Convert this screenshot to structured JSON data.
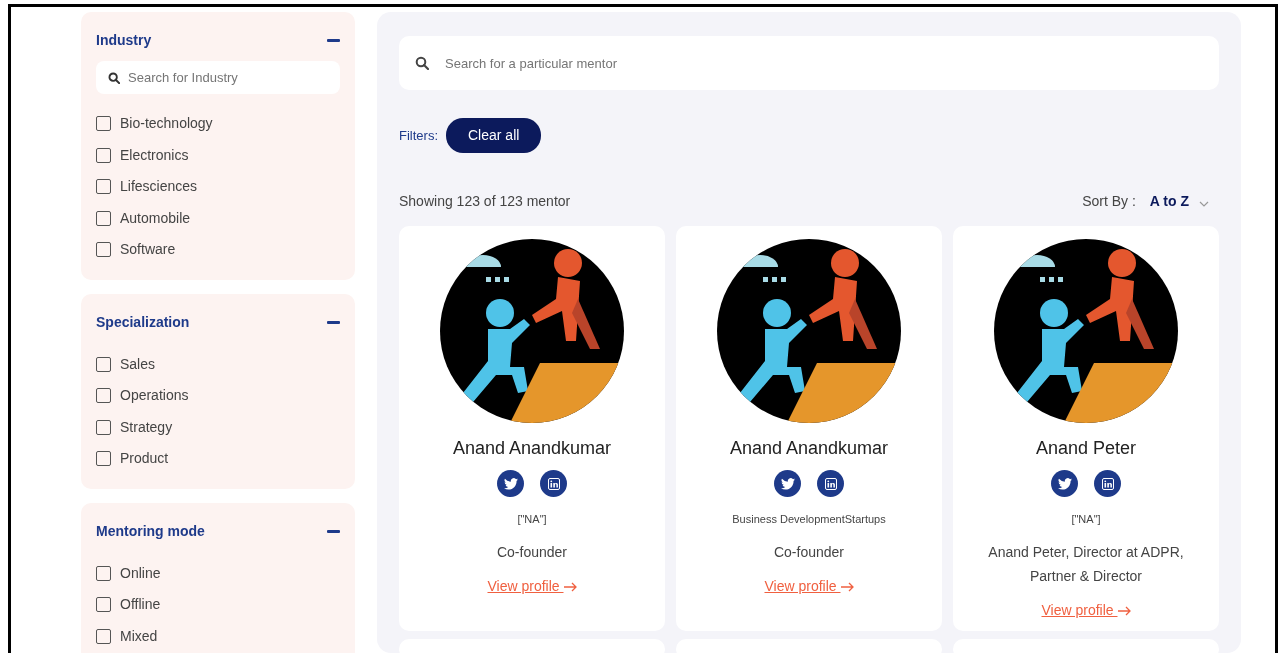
{
  "filters": [
    {
      "title": "Industry",
      "expanded": true,
      "search_placeholder": "Search for Industry",
      "options": [
        {
          "label": "Bio-technology",
          "checked": false
        },
        {
          "label": "Electronics",
          "checked": false
        },
        {
          "label": "Lifesciences",
          "checked": false
        },
        {
          "label": "Automobile",
          "checked": false
        },
        {
          "label": "Software",
          "checked": false
        }
      ]
    },
    {
      "title": "Specialization",
      "expanded": true,
      "options": [
        {
          "label": "Sales",
          "checked": false
        },
        {
          "label": "Operations",
          "checked": false
        },
        {
          "label": "Strategy",
          "checked": false
        },
        {
          "label": "Product",
          "checked": false
        }
      ]
    },
    {
      "title": "Mentoring mode",
      "expanded": true,
      "options": [
        {
          "label": "Online",
          "checked": false
        },
        {
          "label": "Offline",
          "checked": false
        },
        {
          "label": "Mixed",
          "checked": false
        }
      ]
    }
  ],
  "search": {
    "placeholder": "Search for a particular mentor"
  },
  "filters_label": "Filters:",
  "clear_button": "Clear all",
  "results_count": "Showing 123 of 123 mentor",
  "sort": {
    "label": "Sort By :",
    "value": "A to Z"
  },
  "mentors": [
    {
      "name": "Anand Anandkumar",
      "tags": "[\"NA\"]",
      "role": "Co-founder",
      "link": "View profile"
    },
    {
      "name": "Anand Anandkumar",
      "tags": "Business DevelopmentStartups",
      "role": "Co-founder",
      "link": "View profile"
    },
    {
      "name": "Anand Peter",
      "tags": "[\"NA\"]",
      "role": "Anand Peter, Director at ADPR, Partner & Director",
      "link": "View profile"
    }
  ]
}
